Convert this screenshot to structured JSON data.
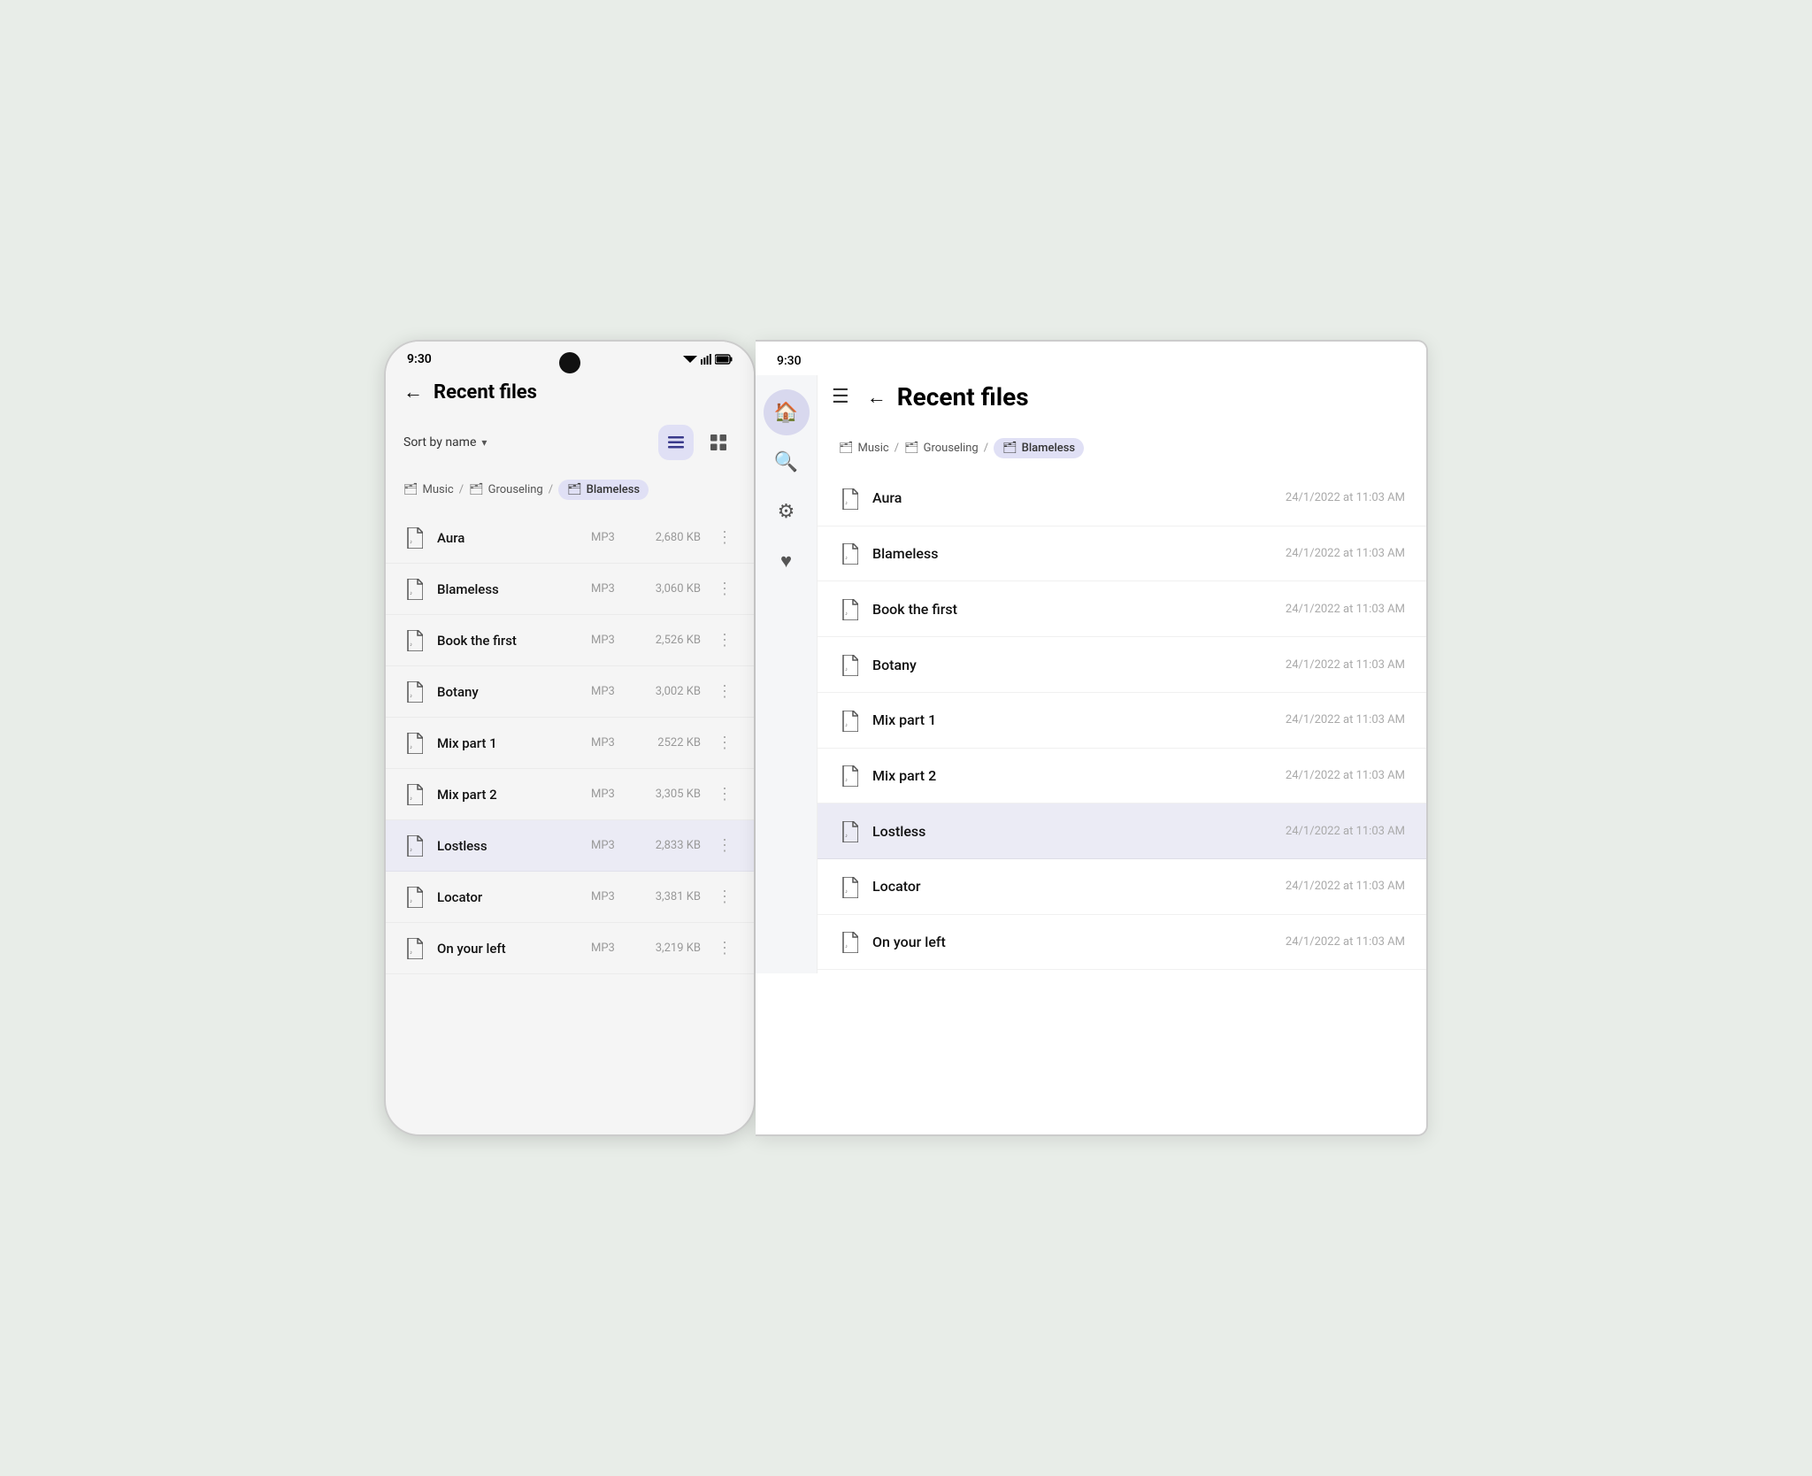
{
  "phoneScreen": {
    "statusBar": {
      "time": "9:30",
      "icons": "▼◀▮"
    },
    "header": {
      "backLabel": "←",
      "title": "Recent files"
    },
    "toolbar": {
      "sortLabel": "Sort by name",
      "chevron": "▾",
      "listViewLabel": "≡",
      "gridViewLabel": "⊞"
    },
    "breadcrumb": [
      {
        "label": "Music",
        "icon": "folder",
        "active": false
      },
      {
        "sep": "/"
      },
      {
        "label": "Grouseling",
        "icon": "folder",
        "active": false
      },
      {
        "sep": "/"
      },
      {
        "label": "Blameless",
        "icon": "folder",
        "active": true
      }
    ],
    "files": [
      {
        "name": "Aura",
        "type": "MP3",
        "size": "2,680 KB",
        "selected": false
      },
      {
        "name": "Blameless",
        "type": "MP3",
        "size": "3,060 KB",
        "selected": false
      },
      {
        "name": "Book the first",
        "type": "MP3",
        "size": "2,526 KB",
        "selected": false
      },
      {
        "name": "Botany",
        "type": "MP3",
        "size": "3,002 KB",
        "selected": false
      },
      {
        "name": "Mix part 1",
        "type": "MP3",
        "size": "2522 KB",
        "selected": false
      },
      {
        "name": "Mix part 2",
        "type": "MP3",
        "size": "3,305 KB",
        "selected": false
      },
      {
        "name": "Lostless",
        "type": "MP3",
        "size": "2,833 KB",
        "selected": true
      },
      {
        "name": "Locator",
        "type": "MP3",
        "size": "3,381 KB",
        "selected": false
      },
      {
        "name": "On your left",
        "type": "MP3",
        "size": "3,219 KB",
        "selected": false
      }
    ]
  },
  "tabletScreen": {
    "statusBar": {
      "time": "9:30"
    },
    "sidebar": {
      "items": [
        {
          "icon": "🏠",
          "label": "home",
          "active": true
        },
        {
          "icon": "🔍",
          "label": "search",
          "active": false
        },
        {
          "icon": "⚙",
          "label": "settings",
          "active": false
        },
        {
          "icon": "♥",
          "label": "favorites",
          "active": false
        }
      ]
    },
    "header": {
      "menuLabel": "☰",
      "backLabel": "←",
      "title": "Recent files"
    },
    "breadcrumb": [
      {
        "label": "Music",
        "icon": "folder",
        "active": false
      },
      {
        "sep": "/"
      },
      {
        "label": "Grouseling",
        "icon": "folder",
        "active": false
      },
      {
        "sep": "/"
      },
      {
        "label": "Blameless",
        "icon": "folder",
        "active": true
      }
    ],
    "files": [
      {
        "name": "Aura",
        "date": "24/1/2022 at 11:03 AM",
        "selected": false
      },
      {
        "name": "Blameless",
        "date": "24/1/2022 at 11:03 AM",
        "selected": false
      },
      {
        "name": "Book the first",
        "date": "24/1/2022 at 11:03 AM",
        "selected": false
      },
      {
        "name": "Botany",
        "date": "24/1/2022 at 11:03 AM",
        "selected": false
      },
      {
        "name": "Mix part 1",
        "date": "24/1/2022 at 11:03 AM",
        "selected": false
      },
      {
        "name": "Mix part 2",
        "date": "24/1/2022 at 11:03 AM",
        "selected": false
      },
      {
        "name": "Lostless",
        "date": "24/1/2022 at 11:03 AM",
        "selected": true
      },
      {
        "name": "Locator",
        "date": "24/1/2022 at 11:03 AM",
        "selected": false
      },
      {
        "name": "On your left",
        "date": "24/1/2022 at 11:03 AM",
        "selected": false
      }
    ]
  }
}
